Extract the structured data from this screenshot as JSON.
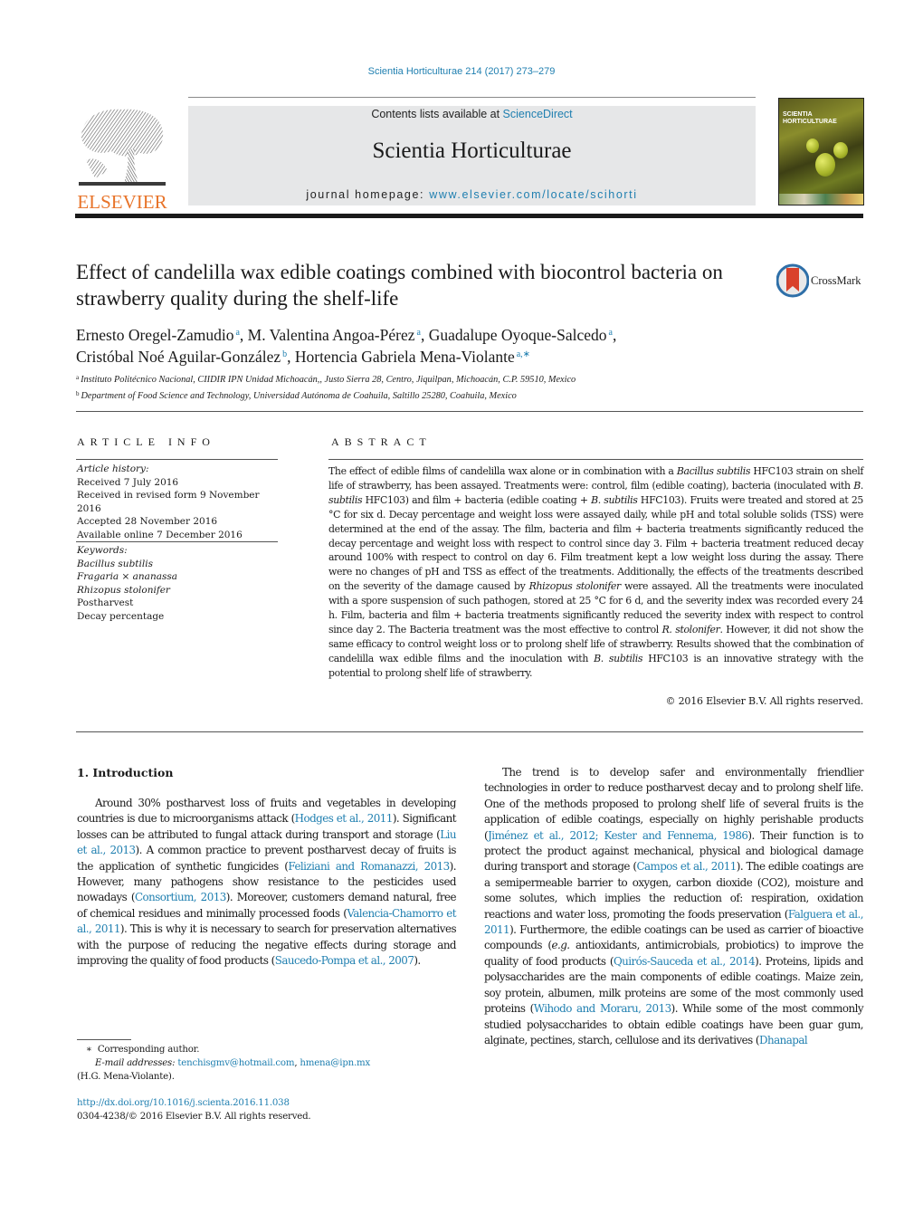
{
  "header": {
    "journal_reference": "Scientia Horticulturae 214 (2017) 273–279",
    "publisher_logo_text": "ELSEVIER",
    "contents_prefix": "Contents lists available at ",
    "contents_link": "ScienceDirect",
    "journal_name": "Scientia Horticulturae",
    "homepage_prefix": "journal homepage: ",
    "homepage_link": "www.elsevier.com/locate/scihorti",
    "cover_title_line1": "SCIENTIA",
    "cover_title_line2": "HORTICULTURAE",
    "crossmark_label": "CrossMark"
  },
  "article": {
    "title": "Effect of candelilla wax edible coatings combined with biocontrol bacteria on strawberry quality during the shelf-life",
    "authors": [
      {
        "name": "Ernesto Oregel-Zamudio",
        "sup": "a",
        "sep": ", "
      },
      {
        "name": "M. Valentina Angoa-Pérez",
        "sup": "a",
        "sep": ", "
      },
      {
        "name": "Guadalupe Oyoque-Salcedo",
        "sup": "a",
        "sep": ","
      },
      {
        "name": "Cristóbal Noé Aguilar-González",
        "sup": "b",
        "sep": ", "
      },
      {
        "name": "Hortencia Gabriela Mena-Violante",
        "sup": "a,∗",
        "sep": ""
      }
    ],
    "affiliations": [
      {
        "mark": "a",
        "text": "Instituto Politécnico Nacional, CIIDIR IPN Unidad Michoacán,, Justo Sierra 28, Centro, Jiquilpan, Michoacán, C.P. 59510, Mexico"
      },
      {
        "mark": "b",
        "text": "Department of Food Science and Technology, Universidad Autónoma de Coahuila, Saltillo 25280, Coahuila, Mexico"
      }
    ]
  },
  "article_info": {
    "heading": "ARTICLE INFO",
    "history_label": "Article history:",
    "history": [
      "Received 7 July 2016",
      "Received in revised form 9 November 2016",
      "Accepted 28 November 2016",
      "Available online 7 December 2016"
    ],
    "keywords_label": "Keywords:",
    "keywords": [
      {
        "text": "Bacillus subtilis",
        "italic": true
      },
      {
        "text": "Fragaria × ananassa",
        "italic": true
      },
      {
        "text": "Rhizopus stolonifer",
        "italic": true
      },
      {
        "text": "Postharvest",
        "italic": false
      },
      {
        "text": "Decay percentage",
        "italic": false
      }
    ]
  },
  "abstract": {
    "heading": "ABSTRACT",
    "segments": [
      {
        "t": "The effect of edible films of candelilla wax alone or in combination with a "
      },
      {
        "t": "Bacillus subtilis",
        "i": true
      },
      {
        "t": " HFC103 strain on shelf life of strawberry, has been assayed. Treatments were: control, film (edible coating), bacteria (inoculated with "
      },
      {
        "t": "B. subtilis",
        "i": true
      },
      {
        "t": " HFC103) and film + bacteria (edible coating + "
      },
      {
        "t": "B. subtilis",
        "i": true
      },
      {
        "t": " HFC103). Fruits were treated and stored at 25 °C for six d. Decay percentage and weight loss were assayed daily, while pH and total soluble solids (TSS) were determined at the end of the assay. The film, bacteria and film + bacteria treatments significantly reduced the decay percentage and weight loss with respect to control since day 3. Film + bacteria treatment reduced decay around 100% with respect to control on day 6. Film treatment kept a low weight loss during the assay. There were no changes of pH and TSS as effect of the treatments. Additionally, the effects of the treatments described on the severity of the damage caused by "
      },
      {
        "t": "Rhizopus stolonifer",
        "i": true
      },
      {
        "t": " were assayed. All the treatments were inoculated with a spore suspension of such pathogen, stored at 25 °C for 6 d, and the severity index was recorded every 24 h. Film, bacteria and film + bacteria treatments significantly reduced the severity index with respect to control since day 2. The Bacteria treatment was the most effective to control "
      },
      {
        "t": "R. stolonifer",
        "i": true
      },
      {
        "t": ". However, it did not show the same efficacy to control weight loss or to prolong shelf life of strawberry. Results showed that the combination of candelilla wax edible films and the inoculation with "
      },
      {
        "t": "B. subtilis",
        "i": true
      },
      {
        "t": " HFC103 is an innovative strategy with the potential to prolong shelf life of strawberry."
      }
    ],
    "copyright": "© 2016 Elsevier B.V. All rights reserved."
  },
  "introduction": {
    "heading": "1.  Introduction",
    "left_paragraph": [
      {
        "t": "Around 30% postharvest loss of fruits and vegetables in developing countries is due to microorganisms attack ("
      },
      {
        "t": "Hodges et al., 2011",
        "link": true
      },
      {
        "t": "). Significant losses can be attributed to fungal attack during transport and storage ("
      },
      {
        "t": "Liu et al., 2013",
        "link": true
      },
      {
        "t": "). A common practice to prevent postharvest decay of fruits is the application of synthetic fungicides ("
      },
      {
        "t": "Feliziani and Romanazzi, 2013",
        "link": true
      },
      {
        "t": "). However, many pathogens show resistance to the pesticides used nowadays ("
      },
      {
        "t": "Consortium, 2013",
        "link": true
      },
      {
        "t": "). Moreover, customers demand natural, free of chemical residues and minimally processed foods ("
      },
      {
        "t": "Valencia-Chamorro et al., 2011",
        "link": true
      },
      {
        "t": "). This is why it is necessary to search for preservation alternatives with the purpose of reducing the negative effects during storage and improving the quality of food products ("
      },
      {
        "t": "Saucedo-Pompa et al., 2007",
        "link": true
      },
      {
        "t": ")."
      }
    ],
    "right_paragraph": [
      {
        "t": "The trend is to develop safer and environmentally friendlier technologies in order to reduce postharvest decay and to prolong shelf life. One of the methods proposed to prolong shelf life of several fruits is the application of edible coatings, especially on highly perishable products ("
      },
      {
        "t": "Jiménez et al., 2012; Kester and Fennema, 1986",
        "link": true
      },
      {
        "t": "). Their function is to protect the product against mechanical, physical and biological damage during transport and storage ("
      },
      {
        "t": "Campos et al., 2011",
        "link": true
      },
      {
        "t": "). The edible coatings are a semipermeable barrier to oxygen, carbon dioxide (CO2), moisture and some solutes, which implies the reduction of: respiration, oxidation reactions and water loss, promoting the foods preservation ("
      },
      {
        "t": "Falguera et al., 2011",
        "link": true
      },
      {
        "t": "). Furthermore, the edible coatings can be used as carrier of bioactive compounds ("
      },
      {
        "t": "e.g.",
        "i": true
      },
      {
        "t": " antioxidants, antimicrobials, probiotics) to improve the quality of food products ("
      },
      {
        "t": "Quirós-Sauceda et al., 2014",
        "link": true
      },
      {
        "t": "). Proteins, lipids and polysaccharides are the main components of edible coatings. Maize zein, soy protein, albumen, milk proteins are some of the most commonly used proteins ("
      },
      {
        "t": "Wihodo and Moraru, 2013",
        "link": true
      },
      {
        "t": "). While some of the most commonly studied polysaccharides to obtain edible coatings have been guar gum, alginate, pectines, starch, cellulose and its derivatives ("
      },
      {
        "t": "Dhanapal",
        "link": true
      }
    ]
  },
  "footnotes": {
    "corresponding_mark": "∗",
    "corresponding_label": "Corresponding author.",
    "email_label": "E-mail addresses:",
    "emails": [
      "tenchisgmv@hotmail.com",
      "hmena@ipn.mx"
    ],
    "email_owner": "(H.G. Mena-Violante).",
    "doi_link": "http://dx.doi.org/10.1016/j.scienta.2016.11.038",
    "issn_copyright": "0304-4238/© 2016 Elsevier B.V. All rights reserved."
  },
  "colors": {
    "link": "#1f7fb0",
    "elsevier_orange": "#e8742a",
    "banner_gray": "#e6e7e8",
    "crossmark_red": "#d9412b",
    "crossmark_blue": "#2e6fa8"
  }
}
